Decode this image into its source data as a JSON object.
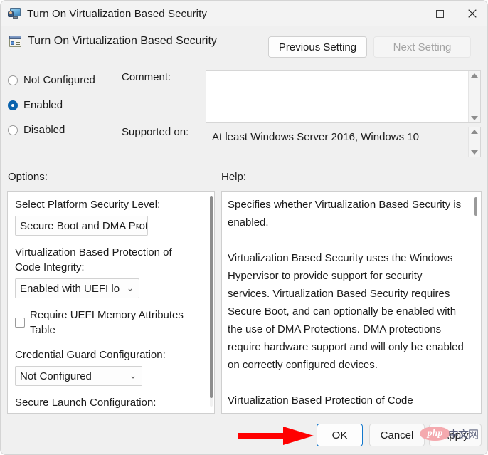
{
  "window": {
    "title": "Turn On Virtualization Based Security",
    "icon": "policy-monitor-icon",
    "controls": {
      "minimize": "minimize-icon",
      "maximize": "maximize-icon",
      "close": "close-icon"
    }
  },
  "header": {
    "icon": "group-policy-setting-icon",
    "title": "Turn On Virtualization Based Security",
    "previous_button": "Previous Setting",
    "next_button": "Next Setting",
    "next_button_disabled": true
  },
  "state": {
    "options": [
      {
        "label": "Not Configured",
        "selected": false
      },
      {
        "label": "Enabled",
        "selected": true
      },
      {
        "label": "Disabled",
        "selected": false
      }
    ]
  },
  "comment": {
    "label": "Comment:",
    "value": "",
    "placeholder": ""
  },
  "supported": {
    "label": "Supported on:",
    "value": "At least Windows Server 2016, Windows 10"
  },
  "options_panel": {
    "label": "Options:",
    "platform_security_label": "Select Platform Security Level:",
    "platform_security_value": "Secure Boot and DMA Prot",
    "code_integrity_label": "Virtualization Based Protection of Code Integrity:",
    "code_integrity_value": "Enabled with UEFI lo",
    "uefi_memory_checkbox_label": "Require UEFI Memory Attributes Table",
    "uefi_memory_checked": false,
    "credential_guard_label": "Credential Guard Configuration:",
    "credential_guard_value": "Not Configured",
    "secure_launch_label": "Secure Launch Configuration:"
  },
  "help_panel": {
    "label": "Help:",
    "paragraphs": [
      "Specifies whether Virtualization Based Security is enabled.",
      "Virtualization Based Security uses the Windows Hypervisor to provide support for security services. Virtualization Based Security requires Secure Boot, and can optionally be enabled with the use of DMA Protections. DMA protections require hardware support and will only be enabled on correctly configured devices.",
      "Virtualization Based Protection of Code"
    ]
  },
  "footer": {
    "ok": "OK",
    "cancel": "Cancel",
    "apply": "Apply"
  },
  "annotation": {
    "arrow_color": "#ff0000",
    "arrow_target": "ok-button"
  },
  "watermark": {
    "brand": "php",
    "suffix": "中文网",
    "ellipse_color": "#f4a9ae"
  }
}
